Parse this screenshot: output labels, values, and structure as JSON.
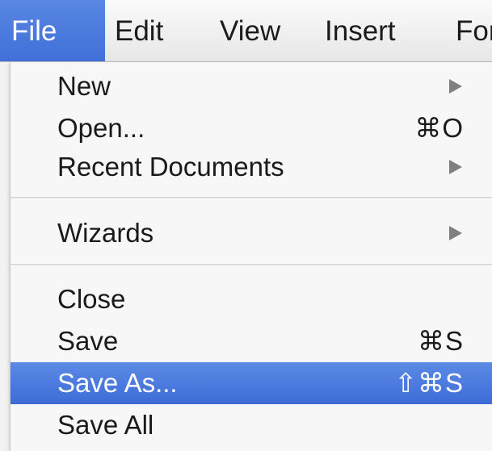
{
  "menubar": {
    "items": [
      {
        "label": "File"
      },
      {
        "label": "Edit"
      },
      {
        "label": "View"
      },
      {
        "label": "Insert"
      },
      {
        "label": "For"
      }
    ],
    "active_index": 0,
    "highlight_color": "#4a7ddf"
  },
  "file_menu": {
    "groups": [
      {
        "items": [
          {
            "label": "New",
            "shortcut": "",
            "submenu": true
          },
          {
            "label": "Open...",
            "shortcut": "⌘O",
            "submenu": false
          },
          {
            "label": "Recent Documents",
            "shortcut": "",
            "submenu": true
          }
        ]
      },
      {
        "items": [
          {
            "label": "Wizards",
            "shortcut": "",
            "submenu": true
          }
        ]
      },
      {
        "items": [
          {
            "label": "Close",
            "shortcut": "",
            "submenu": false
          },
          {
            "label": "Save",
            "shortcut": "⌘S",
            "submenu": false
          },
          {
            "label": "Save As...",
            "shortcut": "⇧⌘S",
            "submenu": false,
            "highlighted": true
          },
          {
            "label": "Save All",
            "shortcut": "",
            "submenu": false
          }
        ]
      }
    ],
    "submenu_icon": "chevron-right-icon",
    "highlight_color": "#4a7ddf"
  }
}
